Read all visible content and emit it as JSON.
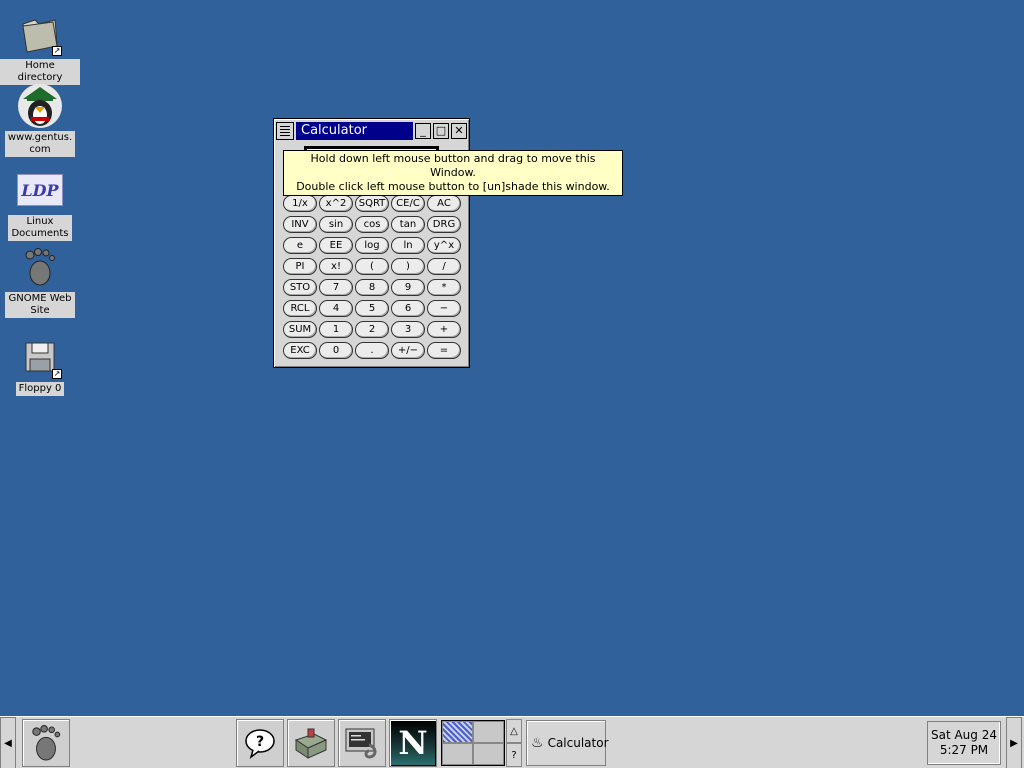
{
  "desktop": {
    "icons": [
      {
        "label": "Home directory"
      },
      {
        "label": "www.gentus.\ncom"
      },
      {
        "label": "Linux\nDocuments",
        "logo_text": "LDP"
      },
      {
        "label": "GNOME Web\nSite"
      },
      {
        "label": "Floppy 0"
      }
    ]
  },
  "window": {
    "title": "Calculator",
    "buttons": [
      "1/x",
      "x^2",
      "SQRT",
      "CE/C",
      "AC",
      "INV",
      "sin",
      "cos",
      "tan",
      "DRG",
      "e",
      "EE",
      "log",
      "ln",
      "y^x",
      "PI",
      "x!",
      "(",
      ")",
      "/",
      "STO",
      "7",
      "8",
      "9",
      "*",
      "RCL",
      "4",
      "5",
      "6",
      "−",
      "SUM",
      "1",
      "2",
      "3",
      "+",
      "EXC",
      "0",
      ".",
      "+/−",
      "="
    ]
  },
  "tooltip": {
    "line1": "Hold down left mouse button and drag to move this Window.",
    "line2": "Double click left mouse button to [un]shade this window."
  },
  "taskbar": {
    "pager_help": "?",
    "task_label": "Calculator",
    "clock_date": "Sat Aug 24",
    "clock_time": "5:27 PM",
    "netscape_letter": "N"
  },
  "colors": {
    "desktop": "#31619a",
    "titlebar": "#00008b",
    "tooltip": "#ffffc6"
  }
}
